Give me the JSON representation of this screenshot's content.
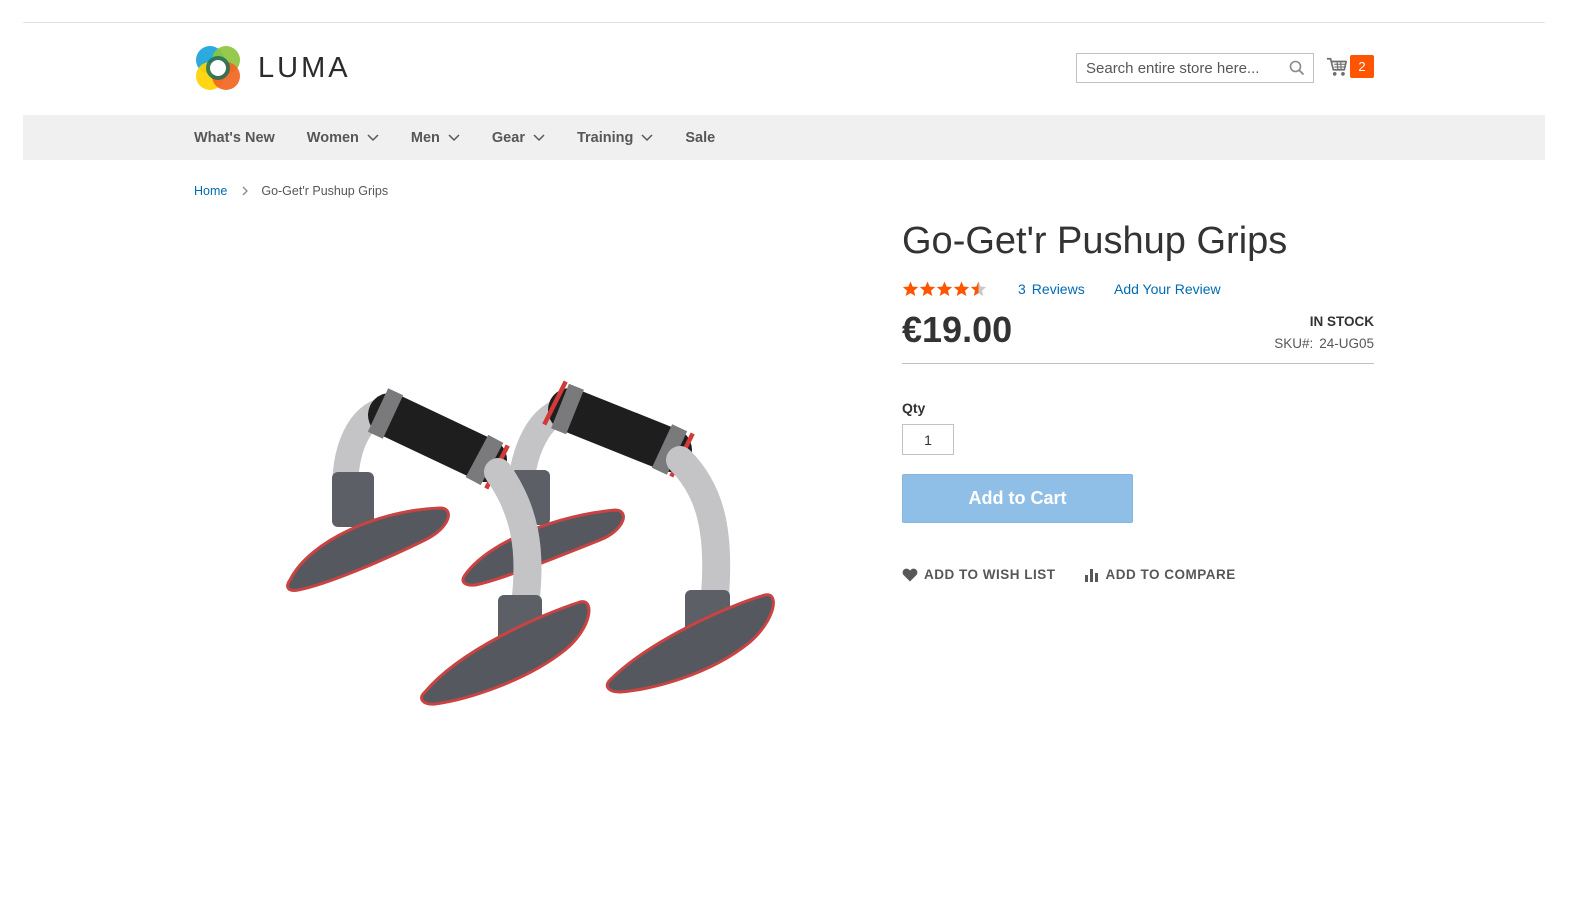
{
  "header": {
    "logo_text": "LUMA",
    "search_placeholder": "Search entire store here...",
    "cart_count": "2"
  },
  "nav": {
    "items": [
      {
        "label": "What's New",
        "has_dropdown": false
      },
      {
        "label": "Women",
        "has_dropdown": true
      },
      {
        "label": "Men",
        "has_dropdown": true
      },
      {
        "label": "Gear",
        "has_dropdown": true
      },
      {
        "label": "Training",
        "has_dropdown": true
      },
      {
        "label": "Sale",
        "has_dropdown": false
      }
    ]
  },
  "breadcrumb": {
    "home": "Home",
    "current": "Go-Get'r Pushup Grips"
  },
  "product": {
    "title": "Go-Get'r Pushup Grips",
    "rating_fraction": 0.9,
    "reviews_count": "3",
    "reviews_label": "Reviews",
    "add_review_label": "Add Your Review",
    "price": "€19.00",
    "stock_status": "In stock",
    "sku_label": "SKU#:",
    "sku_value": "24-UG05",
    "qty_label": "Qty",
    "qty_value": "1",
    "add_to_cart_label": "Add to Cart",
    "wishlist_label": "Add to Wish List",
    "compare_label": "Add to Compare"
  },
  "colors": {
    "accent_orange": "#ff5501",
    "link_blue": "#006bb4",
    "button_blue": "#8fbfe6",
    "nav_bg": "#f0f0f0"
  }
}
